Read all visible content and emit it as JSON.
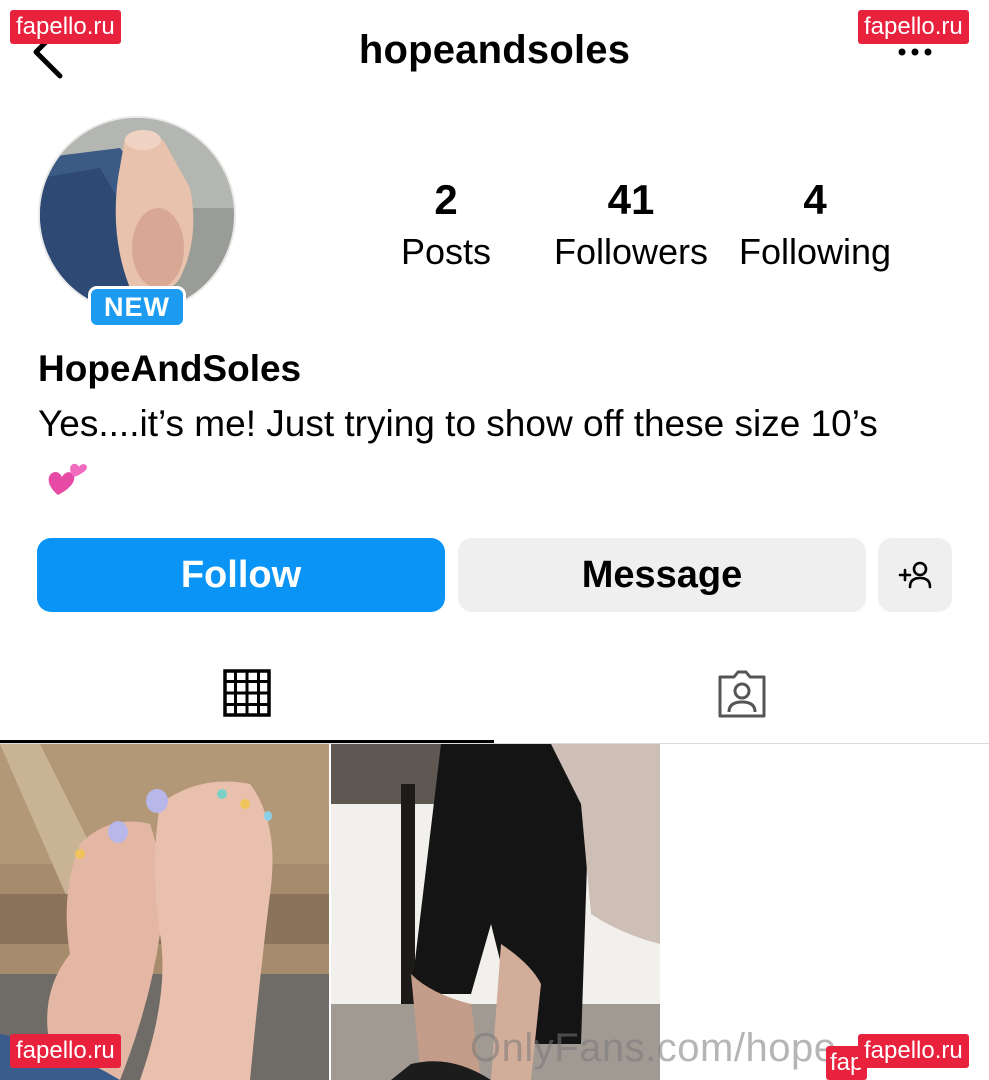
{
  "header": {
    "username": "hopeandsoles",
    "back_icon": "chevron-left-icon",
    "more_icon": "ellipsis-icon"
  },
  "profile": {
    "badge": "NEW",
    "display_name": "HopeAndSoles",
    "bio_text": "Yes....it’s me! Just trying to show off these size 10’s",
    "bio_emoji": "two-hearts-icon"
  },
  "stats": [
    {
      "value": "2",
      "label": "Posts"
    },
    {
      "value": "41",
      "label": "Followers"
    },
    {
      "value": "4",
      "label": "Following"
    }
  ],
  "actions": {
    "follow": "Follow",
    "message": "Message",
    "add_user_icon": "add-user-icon"
  },
  "tabs": {
    "grid_icon": "grid-icon",
    "tagged_icon": "tagged-person-icon",
    "active": "grid"
  },
  "watermarks": {
    "site": "fapello.ru",
    "site_partial": "fap",
    "onlyfans": "OnlyFans.com/hope..."
  },
  "colors": {
    "follow_blue": "#0a95f6",
    "badge_blue": "#1d9bf0",
    "button_gray": "#efefef",
    "watermark_red": "#e8213d"
  }
}
